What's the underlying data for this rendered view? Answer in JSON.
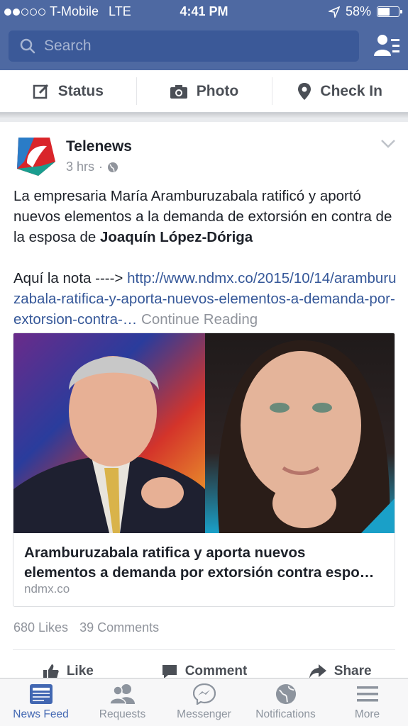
{
  "status_bar": {
    "carrier": "T-Mobile",
    "network": "LTE",
    "time": "4:41 PM",
    "battery": "58%",
    "battery_level": 0.58,
    "signal_bars": 2
  },
  "header": {
    "search_placeholder": "Search",
    "friends_icon": "friend-requests-icon"
  },
  "composer": {
    "status_label": "Status",
    "photo_label": "Photo",
    "checkin_label": "Check In"
  },
  "post": {
    "author": "Telenews",
    "time": "3 hrs",
    "body_text_1": "La empresaria María Aramburuzabala ratificó y aportó nuevos elementos a la demanda de extorsión en contra de la esposa de ",
    "body_bold": "Joaquín López-Dóriga",
    "body_text_2": "Aquí la nota ----> ",
    "body_link": "http://www.ndmx.co/2015/10/14/aramburuzabala-ratifica-y-aporta-nuevos-elementos-a-demanda-por-extorsion-contra-…",
    "continue_label": "Continue Reading",
    "attachment": {
      "title_line_1": "Aramburuzabala ratifica y aporta nuevos",
      "title_line_2": "elementos a demanda por extorsión contra espo…",
      "domain": "ndmx.co"
    },
    "likes": "680 Likes",
    "comments": "39 Comments",
    "actions": {
      "like": "Like",
      "comment": "Comment",
      "share": "Share"
    }
  },
  "tabbar": {
    "items": [
      {
        "label": "News Feed",
        "icon": "news-feed-icon"
      },
      {
        "label": "Requests",
        "icon": "requests-icon"
      },
      {
        "label": "Messenger",
        "icon": "messenger-icon"
      },
      {
        "label": "Notifications",
        "icon": "globe-icon"
      },
      {
        "label": "More",
        "icon": "menu-icon"
      }
    ],
    "active_index": 0
  },
  "colors": {
    "brand_blue": "#4e69a2",
    "search_bg": "#3b5998",
    "link_blue": "#365899",
    "active_tab": "#4267b2"
  }
}
